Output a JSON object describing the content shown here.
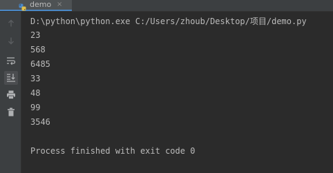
{
  "tab": {
    "label": "demo",
    "icon": "python-icon",
    "close_label": "×"
  },
  "toolbar": {
    "buttons": [
      {
        "icon": "arrow-up-icon",
        "active": false
      },
      {
        "icon": "arrow-down-icon",
        "active": false
      },
      {
        "icon": "soft-wrap-icon",
        "active": false
      },
      {
        "icon": "scroll-to-end-icon",
        "active": true
      },
      {
        "icon": "print-icon",
        "active": false
      },
      {
        "icon": "trash-icon",
        "active": false
      }
    ]
  },
  "console": {
    "command": "D:\\python\\python.exe C:/Users/zhoub/Desktop/项目/demo.py",
    "output": [
      "23",
      "568",
      "6485",
      "33",
      "48",
      "99",
      "3546"
    ],
    "blank": "",
    "exit_message": "Process finished with exit code 0"
  },
  "colors": {
    "background": "#2b2b2b",
    "panel": "#3c3f41",
    "text": "#bbbbbb",
    "tab_underline": "#4a88c7"
  }
}
